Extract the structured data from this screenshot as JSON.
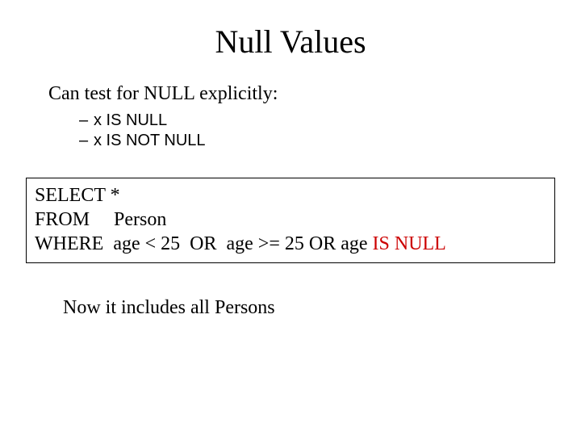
{
  "title": "Null Values",
  "lead": "Can test for NULL explicitly:",
  "bullets": {
    "dash": "–",
    "b1": "x IS NULL",
    "b2": "x IS NOT NULL"
  },
  "query": {
    "kw_select": "SELECT ",
    "star": "*",
    "kw_from": "FROM     ",
    "from_rest": "Person",
    "kw_where": "WHERE  ",
    "where_rest1": "age < 25  OR  age >= 25 OR age ",
    "is_null": "IS NULL"
  },
  "conclusion": "Now it includes all Persons"
}
